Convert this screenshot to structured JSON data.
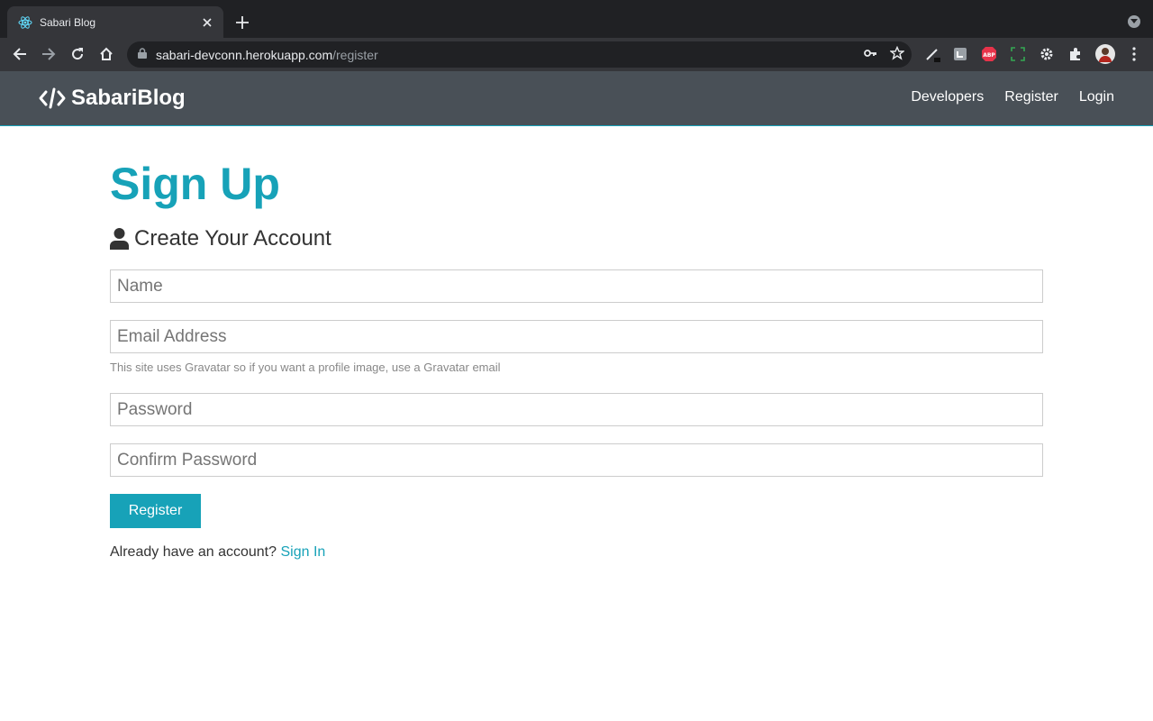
{
  "browser": {
    "tab_title": "Sabari Blog",
    "url_host": "sabari-devconn.herokuapp.com",
    "url_path": "/register"
  },
  "navbar": {
    "brand": "SabariBlog",
    "links": [
      "Developers",
      "Register",
      "Login"
    ]
  },
  "page": {
    "title": "Sign Up",
    "lead": "Create Your Account",
    "fields": {
      "name_placeholder": "Name",
      "email_placeholder": "Email Address",
      "email_help": "This site uses Gravatar so if you want a profile image, use a Gravatar email",
      "password_placeholder": "Password",
      "password2_placeholder": "Confirm Password"
    },
    "submit_label": "Register",
    "signin_prompt": "Already have an account?",
    "signin_link": "Sign In"
  },
  "colors": {
    "primary": "#17a2b8",
    "navbar_bg": "#495057",
    "chrome_dark": "#202124",
    "chrome_toolbar": "#35363a"
  },
  "icons": {
    "brand": "code-icon",
    "lead": "user-icon",
    "favicon": "react-icon"
  }
}
